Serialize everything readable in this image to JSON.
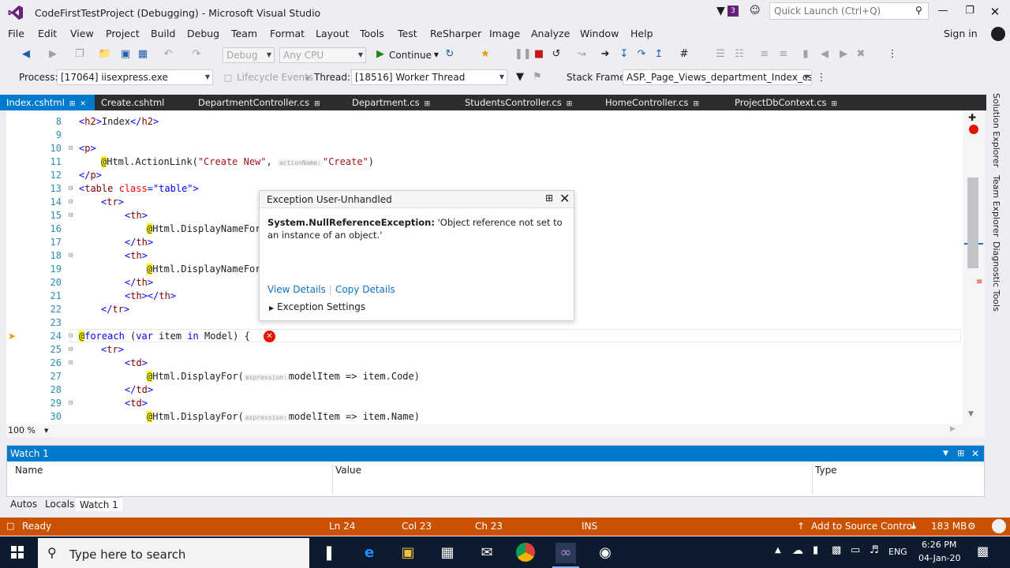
{
  "window": {
    "title": "CodeFirstTestProject (Debugging) - Microsoft Visual Studio",
    "notification_count": "3",
    "quick_launch_placeholder": "Quick Launch (Ctrl+Q)",
    "sign_in": "Sign in"
  },
  "menu": [
    "File",
    "Edit",
    "View",
    "Project",
    "Build",
    "Debug",
    "Team",
    "Format",
    "Layout",
    "Tools",
    "Test",
    "ReSharper",
    "Image",
    "Analyze",
    "Window",
    "Help"
  ],
  "toolbar": {
    "config": "Debug",
    "platform": "Any CPU",
    "continue": "Continue"
  },
  "debug_location": {
    "process_label": "Process:",
    "process": "[17064] iisexpress.exe",
    "lifecycle": "Lifecycle Events",
    "thread_label": "Thread:",
    "thread": "[18516] Worker Thread",
    "stack_label": "Stack Frame:",
    "stack": "ASP._Page_Views_department_Index_cshtr"
  },
  "tabs": [
    "Index.cshtml",
    "Create.cshtml",
    "DepartmentController.cs",
    "Department.cs",
    "StudentsController.cs",
    "HomeController.cs",
    "ProjectDbContext.cs"
  ],
  "code": {
    "lines": [
      "8",
      "9",
      "10",
      "11",
      "12",
      "13",
      "14",
      "15",
      "16",
      "17",
      "18",
      "19",
      "20",
      "21",
      "22",
      "23",
      "24",
      "25",
      "26",
      "27",
      "28",
      "29",
      "30"
    ],
    "hint_action": "actionName:",
    "hint_expr": "expression:"
  },
  "exception": {
    "title": "Exception User-Unhandled",
    "type": "System.NullReferenceException:",
    "message": "'Object reference not set to an instance of an object.'",
    "view_details": "View Details",
    "copy_details": "Copy Details",
    "settings": "Exception Settings"
  },
  "side_tabs": [
    "Solution Explorer",
    "Team Explorer",
    "Diagnostic Tools"
  ],
  "zoom": "100 %",
  "watch": {
    "title": "Watch 1",
    "columns": [
      "Name",
      "Value",
      "Type"
    ]
  },
  "bottom_tabs": [
    "Autos",
    "Locals",
    "Watch 1"
  ],
  "status": {
    "ready": "Ready",
    "ln": "Ln 24",
    "col": "Col 23",
    "ch": "Ch 23",
    "ins": "INS",
    "source_control": "Add to Source Control",
    "memory": "183 MB"
  },
  "taskbar": {
    "search_placeholder": "Type here to search",
    "lang": "ENG",
    "time": "6:26 PM",
    "date": "04-Jan-20"
  },
  "colors": {
    "accent": "#007acc",
    "status_debug": "#ca5100",
    "error": "#e51400"
  }
}
